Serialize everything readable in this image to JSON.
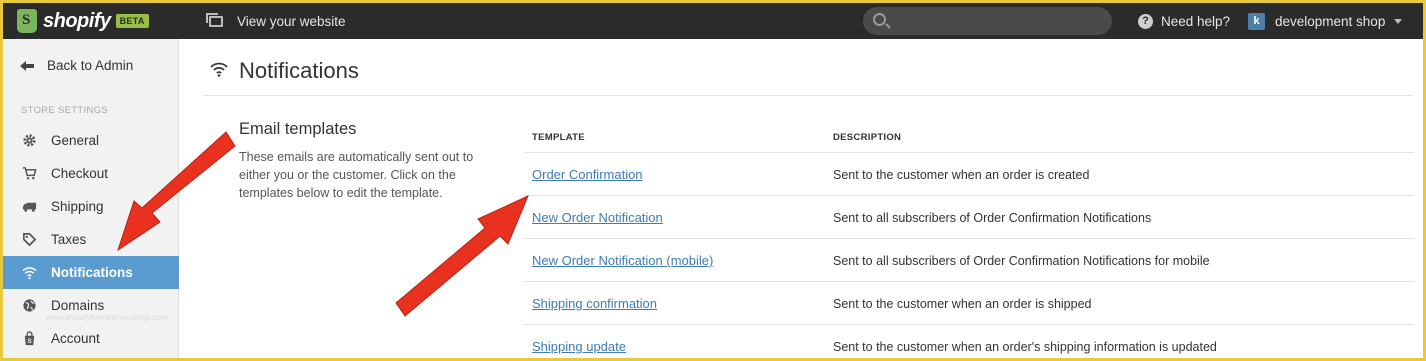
{
  "topbar": {
    "logo_text": "shopify",
    "beta_badge": "BETA",
    "view_site_label": "View your website",
    "search_placeholder": "",
    "help_label": "Need help?",
    "shop_initial": "k",
    "shop_name": "development shop"
  },
  "sidebar": {
    "back_label": "Back to Admin",
    "section_label": "STORE SETTINGS",
    "items": [
      {
        "label": "General",
        "icon": "gear-icon"
      },
      {
        "label": "Checkout",
        "icon": "cart-icon"
      },
      {
        "label": "Shipping",
        "icon": "truck-icon"
      },
      {
        "label": "Taxes",
        "icon": "tag-icon"
      },
      {
        "label": "Notifications",
        "icon": "wifi-icon",
        "active": true
      },
      {
        "label": "Domains",
        "icon": "globe-icon"
      },
      {
        "label": "Account",
        "icon": "bag-icon"
      }
    ]
  },
  "main": {
    "title": "Notifications",
    "intro_title": "Email templates",
    "intro_text": "These emails are automatically sent out to either you or the customer. Click on the templates below to edit the template.",
    "table": {
      "headers": [
        "TEMPLATE",
        "DESCRIPTION"
      ],
      "rows": [
        {
          "name": "Order Confirmation",
          "description": "Sent to the customer when an order is created"
        },
        {
          "name": "New Order Notification",
          "description": "Sent to all subscribers of Order Confirmation Notifications"
        },
        {
          "name": "New Order Notification (mobile)",
          "description": "Sent to all subscribers of Order Confirmation Notifications for mobile"
        },
        {
          "name": "Shipping confirmation",
          "description": "Sent to the customer when an order is shipped"
        },
        {
          "name": "Shipping update",
          "description": "Sent to the customer when an order's shipping information is updated"
        }
      ]
    }
  },
  "watermark": "www.shopifyfreeonlinecollege.com",
  "colors": {
    "topbar_bg": "#2b2b2b",
    "active_nav": "#5a9bd0",
    "link": "#3d7cb8",
    "annotation_arrow": "#e8321f",
    "frame_border": "#e8c93a"
  }
}
